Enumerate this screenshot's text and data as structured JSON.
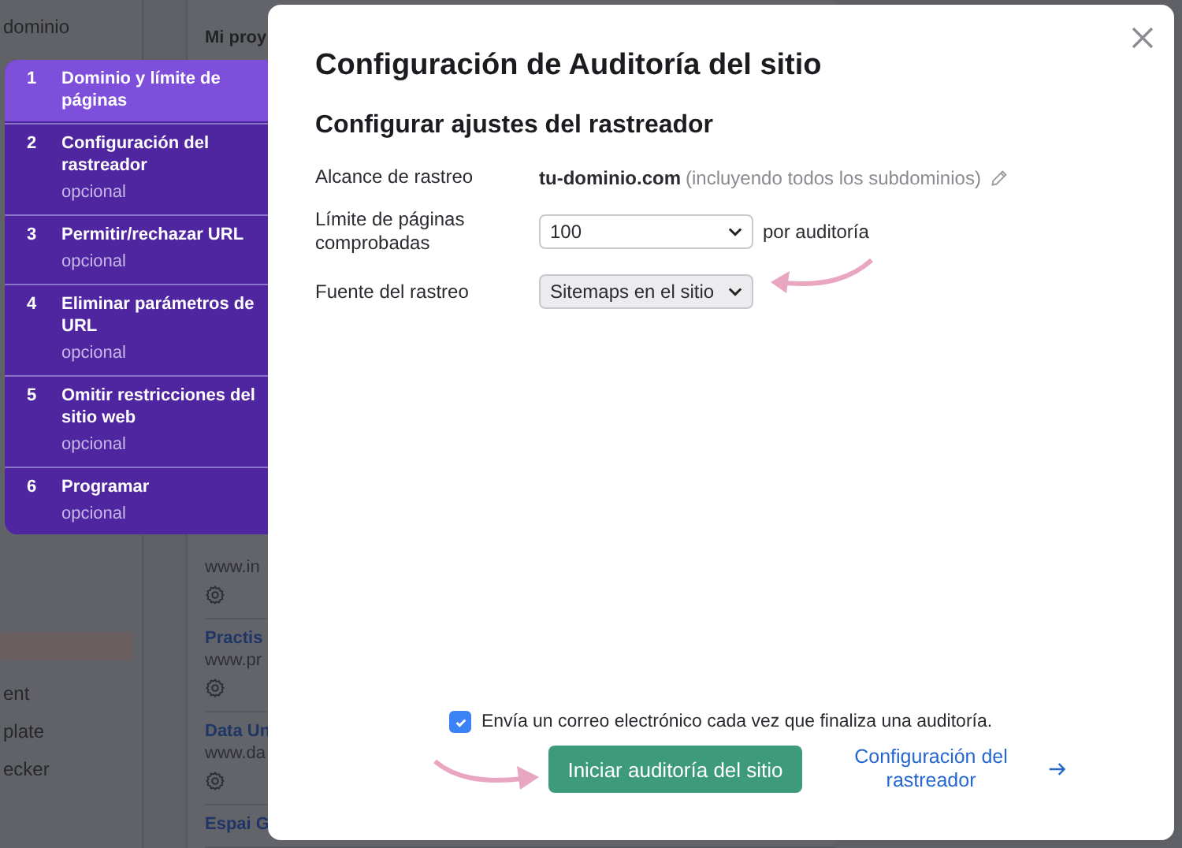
{
  "background": {
    "sidebar_items": [
      {
        "label": "dominio",
        "kind": "item"
      },
      {
        "kind": "highlight"
      },
      {
        "label": "ent",
        "kind": "item"
      },
      {
        "label": "plate",
        "kind": "item"
      },
      {
        "label": "ecker",
        "kind": "item"
      }
    ],
    "projects_heading": "Mi proy",
    "projects": [
      {
        "url": "www.in"
      },
      {
        "name": "Practis",
        "url": "www.pr"
      },
      {
        "name": "Data Un",
        "url": "www.da"
      },
      {
        "name": "Espai G"
      }
    ]
  },
  "steps": [
    {
      "number": "1",
      "title": "Dominio y límite de páginas",
      "selected": true
    },
    {
      "number": "2",
      "title": "Configuración del rastreador",
      "subtitle": "opcional",
      "selected": false
    },
    {
      "number": "3",
      "title": "Permitir/rechazar URL",
      "subtitle": "opcional",
      "selected": false
    },
    {
      "number": "4",
      "title": "Eliminar parámetros de URL",
      "subtitle": "opcional",
      "selected": false
    },
    {
      "number": "5",
      "title": "Omitir restricciones del sitio web",
      "subtitle": "opcional",
      "selected": false
    },
    {
      "number": "6",
      "title": "Programar",
      "subtitle": "opcional",
      "selected": false
    }
  ],
  "modal": {
    "title": "Configuración de Auditoría del sitio",
    "subtitle": "Configurar ajustes del rastreador",
    "fields": [
      {
        "label": "Alcance de rastreo",
        "kind": "text",
        "value": "tu-dominio.com",
        "note": "(incluyendo todos los subdominios)"
      },
      {
        "label": "Límite de páginas comprobadas",
        "kind": "select",
        "value": "100",
        "note": "por auditoría"
      },
      {
        "label": "Fuente del rastreo",
        "kind": "select",
        "value": "Sitemaps en el sitio"
      }
    ],
    "email_notification": {
      "label": "Envía un correo electrónico cada vez que finaliza una auditoría.",
      "checked": true
    },
    "primary_button": "Iniciar auditoría del sitio",
    "secondary_link": "Configuración del rastreador"
  }
}
